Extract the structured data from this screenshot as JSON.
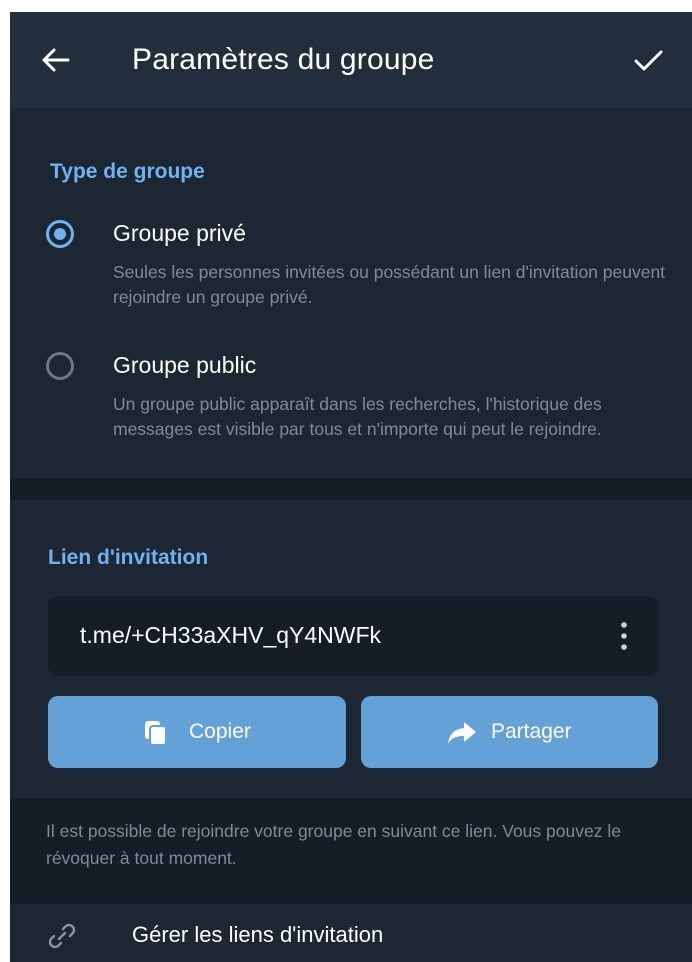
{
  "header": {
    "title": "Paramètres du groupe",
    "back_icon": "arrow-left-icon",
    "confirm_icon": "check-icon"
  },
  "group_type": {
    "section_title": "Type de groupe",
    "options": [
      {
        "label": "Groupe privé",
        "description": "Seules les personnes invitées ou possédant un lien d'invitation peuvent rejoindre un groupe privé.",
        "selected": true
      },
      {
        "label": "Groupe public",
        "description": "Un groupe public apparaît dans les recherches, l'historique des messages est visible par tous et n'importe qui peut le rejoindre.",
        "selected": false
      }
    ]
  },
  "invite": {
    "section_title": "Lien d'invitation",
    "link": "t.me/+CH33aXHV_qY4NWFk",
    "more_icon": "more-vertical-icon",
    "copy_label": "Copier",
    "copy_icon": "copy-icon",
    "share_label": "Partager",
    "share_icon": "share-arrow-icon",
    "note": "Il est possible de rejoindre votre groupe en suivant ce lien. Vous pouvez le révoquer à tout moment."
  },
  "manage": {
    "label": "Gérer les liens d'invitation",
    "icon": "link-icon"
  },
  "colors": {
    "accent": "#6fb2ef",
    "button": "#64a1d6",
    "background": "#1d2733",
    "header": "#232e3c",
    "secondary_text": "#7f8b98"
  }
}
